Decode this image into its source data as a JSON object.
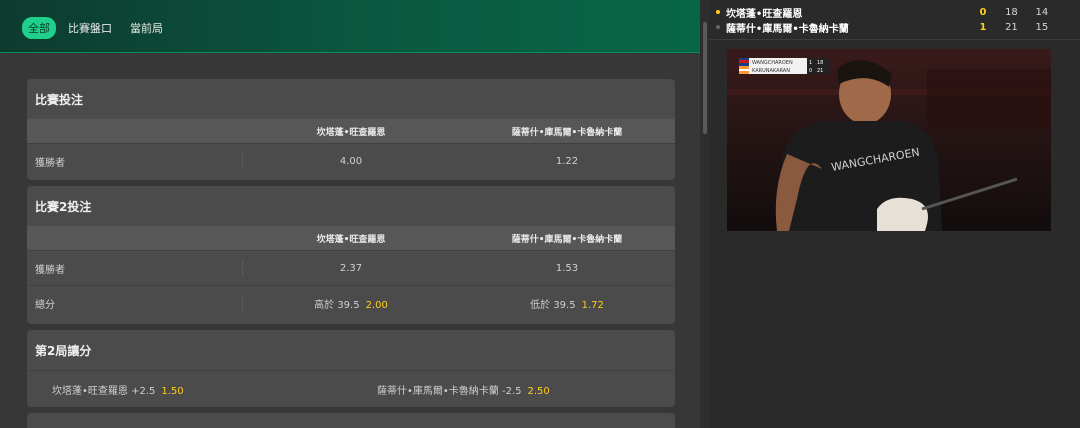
{
  "tabs": [
    {
      "label": "全部",
      "active": true
    },
    {
      "label": "比賽盤口",
      "active": false
    },
    {
      "label": "當前局",
      "active": false
    }
  ],
  "match_bet": {
    "title": "比賽投注",
    "player1": "坎塔蓬•旺查羅恩",
    "player2": "薩蒂什•庫馬爾•卡魯納卡蘭",
    "rows": [
      {
        "label": "獲勝者",
        "odd1": "4.00",
        "odd2": "1.22"
      }
    ]
  },
  "game2_bet": {
    "title": "比賽2投注",
    "player1": "坎塔蓬•旺查羅恩",
    "player2": "薩蒂什•庫馬爾•卡魯納卡蘭",
    "winner": {
      "label": "獲勝者",
      "odd1": "2.37",
      "odd2": "1.53"
    },
    "total": {
      "label": "總分",
      "over_label": "高於 39.5",
      "over_odd": "2.00",
      "under_label": "低於 39.5",
      "under_odd": "1.72"
    }
  },
  "handicap": {
    "title": "第2局讓分",
    "left_label": "坎塔蓬•旺查羅恩 +2.5",
    "left_odd": "1.50",
    "right_label": "薩蒂什•庫馬爾•卡魯納卡蘭 -2.5",
    "right_odd": "2.50"
  },
  "scoreboard": [
    {
      "name": "坎塔蓬•旺查羅恩",
      "sets": "0",
      "g1": "18",
      "g2": "14",
      "serving": true
    },
    {
      "name": "薩蒂什•庫馬爾•卡魯納卡蘭",
      "sets": "1",
      "g1": "21",
      "g2": "15",
      "serving": false
    }
  ],
  "video_overlay": {
    "p1": "WANGCHAROEN",
    "p1_sets": "1",
    "p1_pts": "18",
    "p2": "KARUNAKARAN",
    "p2_sets": "0",
    "p2_pts": "21"
  },
  "colors": {
    "accent": "#1fd08c",
    "odds": "#ffcd1a",
    "header_green": "#0a5b41"
  }
}
